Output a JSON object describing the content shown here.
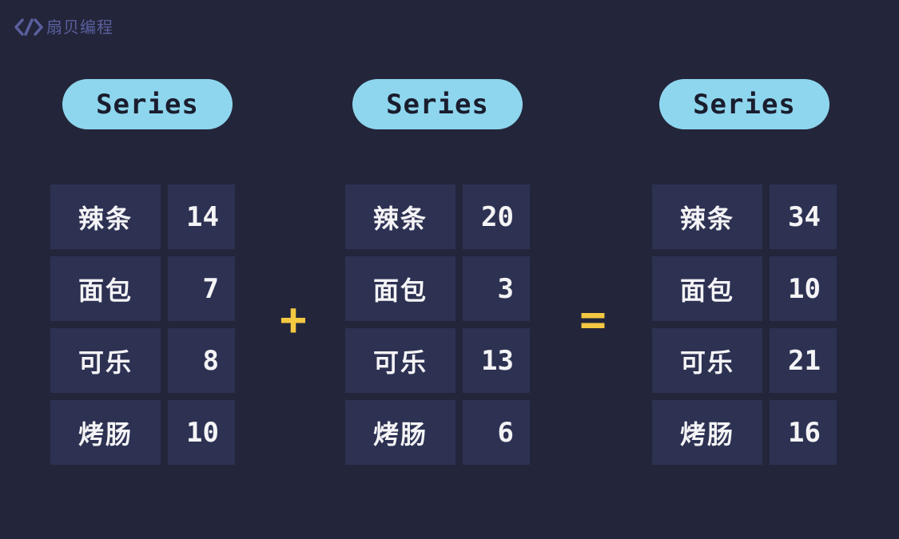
{
  "brand": {
    "name": "扇贝编程",
    "logo_icon": "code-brackets-icon",
    "color": "#5a5f9e"
  },
  "colors": {
    "background": "#23263a",
    "cell": "#2d3152",
    "pill": "#8ed6ee",
    "operator": "#f5c842"
  },
  "series": [
    {
      "label": "Series",
      "rows": [
        {
          "key": "辣条",
          "value": "14"
        },
        {
          "key": "面包",
          "value": "7"
        },
        {
          "key": "可乐",
          "value": "8"
        },
        {
          "key": "烤肠",
          "value": "10"
        }
      ]
    },
    {
      "label": "Series",
      "rows": [
        {
          "key": "辣条",
          "value": "20"
        },
        {
          "key": "面包",
          "value": "3"
        },
        {
          "key": "可乐",
          "value": "13"
        },
        {
          "key": "烤肠",
          "value": "6"
        }
      ]
    },
    {
      "label": "Series",
      "rows": [
        {
          "key": "辣条",
          "value": "34"
        },
        {
          "key": "面包",
          "value": "10"
        },
        {
          "key": "可乐",
          "value": "21"
        },
        {
          "key": "烤肠",
          "value": "16"
        }
      ]
    }
  ],
  "operators": {
    "plus": "+",
    "equals": "="
  }
}
